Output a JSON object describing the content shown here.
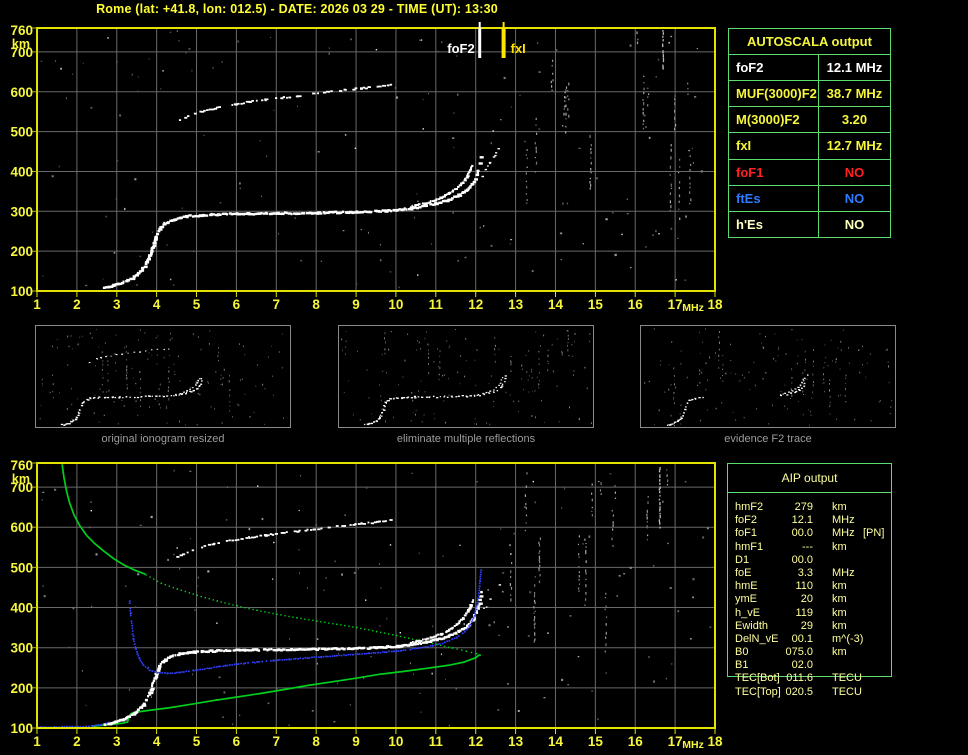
{
  "title": "Rome (lat: +41.8, lon: 012.5) - DATE: 2026 03 29 - TIME (UT): 13:30",
  "colors": {
    "background": "#000000",
    "axis_yellow": "#f6f63c",
    "plot_border": "#e3e300",
    "grid": "#696969",
    "table_border": "#5adc6e",
    "echo_white": "#ffffff",
    "profile_green": "#00cf1d",
    "restored_blue": "#2e3eff",
    "caption_gray": "#9c9c9c",
    "aip_text": "#ffff9c"
  },
  "axes": {
    "x_ticks": [
      "1",
      "2",
      "3",
      "4",
      "5",
      "6",
      "7",
      "8",
      "9",
      "10",
      "11",
      "12",
      "13",
      "14",
      "15",
      "16",
      "17",
      "18"
    ],
    "x_unit": "MHz",
    "y_ticks": [
      "760",
      "700",
      "600",
      "500",
      "400",
      "300",
      "200",
      "100"
    ],
    "y_unit": "km",
    "x_range": [
      1,
      18
    ],
    "y_range": [
      100,
      760
    ]
  },
  "markers": {
    "fof2": {
      "label": "foF2",
      "freq_mhz": 12.1,
      "color": "#ffffff"
    },
    "fxi": {
      "label": "fxI",
      "freq_mhz": 12.7,
      "color": "#ffe400"
    }
  },
  "autoscala": {
    "header": "AUTOSCALA output",
    "rows": [
      {
        "label": "foF2",
        "value": "12.1 MHz",
        "color": "#ffffff"
      },
      {
        "label": "MUF(3000)F2",
        "value": "38.7 MHz",
        "color": "#f6f63c"
      },
      {
        "label": "M(3000)F2",
        "value": "3.20",
        "color": "#f6f63c"
      },
      {
        "label": "fxI",
        "value": "12.7 MHz",
        "color": "#f6f63c"
      },
      {
        "label": "foF1",
        "value": "NO",
        "color": "#ff2222"
      },
      {
        "label": "ftEs",
        "value": "NO",
        "color": "#2e7bff"
      },
      {
        "label": "h'Es",
        "value": "NO",
        "color": "#ffffc0"
      }
    ]
  },
  "aip": {
    "header": "AIP output",
    "rows": [
      {
        "label": "hmF2",
        "value": "279",
        "unit": "km",
        "note": ""
      },
      {
        "label": "foF2",
        "value": "12.1",
        "unit": "MHz",
        "note": ""
      },
      {
        "label": "foF1",
        "value": "00.0",
        "unit": "MHz",
        "note": "[PN]"
      },
      {
        "label": "hmF1",
        "value": "---",
        "unit": "km",
        "note": ""
      },
      {
        "label": "D1",
        "value": "00.0",
        "unit": "",
        "note": ""
      },
      {
        "label": "foE",
        "value": "3.3",
        "unit": "MHz",
        "note": ""
      },
      {
        "label": "hmE",
        "value": "110",
        "unit": "km",
        "note": ""
      },
      {
        "label": "ymE",
        "value": "20",
        "unit": "km",
        "note": ""
      },
      {
        "label": "h_vE",
        "value": "119",
        "unit": "km",
        "note": ""
      },
      {
        "label": "Ewidth",
        "value": "29",
        "unit": "km",
        "note": ""
      },
      {
        "label": "DelN_vE",
        "value": "00.1",
        "unit": "m^(-3)",
        "note": ""
      },
      {
        "label": "B0",
        "value": "075.0",
        "unit": "km",
        "note": ""
      },
      {
        "label": "B1",
        "value": "02.0",
        "unit": "",
        "note": ""
      },
      {
        "label": "TEC[Bot]",
        "value": "011.6",
        "unit": "TECU",
        "note": ""
      },
      {
        "label": "TEC[Top]",
        "value": "020.5",
        "unit": "TECU",
        "note": ""
      }
    ]
  },
  "panels": [
    {
      "caption": "original ionogram resized",
      "traces": [
        "main",
        "branch2",
        "hop2"
      ]
    },
    {
      "caption": "eliminate multiple reflections",
      "traces": [
        "main",
        "branch2"
      ]
    },
    {
      "caption": "evidence F2 trace",
      "traces": [
        "frag1",
        "frag2",
        "frag2b"
      ]
    }
  ],
  "chart_data": {
    "type": "scatter",
    "xlabel": "MHz",
    "ylabel": "km",
    "xlim": [
      1,
      18
    ],
    "ylim": [
      100,
      760
    ],
    "plots": [
      {
        "name": "scaled-ionogram",
        "traces": [
          "main",
          "branch2",
          "hop2",
          "xmode"
        ],
        "markers": [
          "foF2 12.1 MHz",
          "fxI 12.7 MHz"
        ]
      },
      {
        "name": "ionogram-with-profile",
        "traces": [
          "green_top_solid",
          "green_top_dot",
          "green_bottom",
          "blue_E",
          "main",
          "branch2",
          "hop2",
          "xmode",
          "blue_F"
        ]
      }
    ],
    "traces": {
      "main": {
        "style": "blocks",
        "color": "#ffffff",
        "points": [
          [
            2.65,
            110
          ],
          [
            2.8,
            114
          ],
          [
            2.95,
            118
          ],
          [
            3.1,
            124
          ],
          [
            3.25,
            130
          ],
          [
            3.4,
            138
          ],
          [
            3.52,
            148
          ],
          [
            3.63,
            160
          ],
          [
            3.72,
            174
          ],
          [
            3.8,
            192
          ],
          [
            3.87,
            212
          ],
          [
            3.95,
            236
          ],
          [
            4.05,
            258
          ],
          [
            4.18,
            272
          ],
          [
            4.35,
            281
          ],
          [
            4.55,
            287
          ],
          [
            4.8,
            291
          ],
          [
            5.1,
            293
          ],
          [
            5.5,
            295
          ],
          [
            6.0,
            297
          ],
          [
            6.5,
            297
          ],
          [
            7.0,
            298
          ],
          [
            7.5,
            298
          ],
          [
            8.0,
            299
          ],
          [
            8.5,
            300
          ],
          [
            9.0,
            301
          ],
          [
            9.5,
            303
          ],
          [
            10.0,
            306
          ],
          [
            10.35,
            310
          ],
          [
            10.7,
            316
          ],
          [
            11.0,
            323
          ],
          [
            11.3,
            332
          ],
          [
            11.55,
            343
          ],
          [
            11.75,
            356
          ],
          [
            11.88,
            370
          ],
          [
            11.97,
            386
          ],
          [
            12.03,
            404
          ],
          [
            12.07,
            422
          ],
          [
            12.1,
            442
          ]
        ]
      },
      "branch2": {
        "style": "blocks2",
        "color": "#ffffff",
        "points": [
          [
            10.35,
            314
          ],
          [
            10.6,
            320
          ],
          [
            10.85,
            327
          ],
          [
            11.1,
            336
          ],
          [
            11.3,
            347
          ],
          [
            11.5,
            360
          ],
          [
            11.65,
            375
          ],
          [
            11.77,
            392
          ],
          [
            11.85,
            408
          ],
          [
            11.9,
            422
          ]
        ]
      },
      "hop2": {
        "style": "dotblocks",
        "color": "#ffffff",
        "points": [
          [
            4.5,
            528
          ],
          [
            4.75,
            540
          ],
          [
            5.0,
            550
          ],
          [
            5.3,
            558
          ],
          [
            5.6,
            565
          ],
          [
            5.95,
            571
          ],
          [
            6.3,
            577
          ],
          [
            6.7,
            582
          ],
          [
            7.1,
            587
          ],
          [
            7.5,
            592
          ],
          [
            7.9,
            597
          ],
          [
            8.3,
            602
          ],
          [
            8.7,
            607
          ],
          [
            9.1,
            611
          ],
          [
            9.5,
            615
          ],
          [
            9.85,
            619
          ]
        ]
      },
      "xmode": {
        "style": "sparse",
        "color": "#ffffff",
        "points": [
          [
            12.15,
            390
          ],
          [
            12.25,
            405
          ],
          [
            12.35,
            422
          ],
          [
            12.45,
            440
          ],
          [
            12.55,
            458
          ]
        ]
      },
      "blue_E": {
        "style": "dots",
        "color": "#2e3eff",
        "points": [
          [
            1.0,
            104
          ],
          [
            1.2,
            104
          ],
          [
            1.4,
            104
          ],
          [
            1.6,
            105
          ],
          [
            1.8,
            105
          ],
          [
            2.0,
            105
          ],
          [
            2.2,
            106
          ],
          [
            2.35,
            107
          ],
          [
            2.5,
            109
          ],
          [
            2.65,
            112
          ],
          [
            2.78,
            116
          ]
        ]
      },
      "blue_F": {
        "style": "dots",
        "color": "#2e3eff",
        "points": [
          [
            3.3,
            418
          ],
          [
            3.33,
            388
          ],
          [
            3.36,
            356
          ],
          [
            3.4,
            324
          ],
          [
            3.46,
            298
          ],
          [
            3.54,
            276
          ],
          [
            3.65,
            258
          ],
          [
            3.8,
            246
          ],
          [
            4.0,
            240
          ],
          [
            4.25,
            238
          ],
          [
            4.55,
            240
          ],
          [
            4.9,
            245
          ],
          [
            5.3,
            251
          ],
          [
            5.7,
            257
          ],
          [
            6.1,
            262
          ],
          [
            6.5,
            266
          ],
          [
            6.9,
            270
          ],
          [
            7.3,
            273
          ],
          [
            7.7,
            276
          ],
          [
            8.1,
            279
          ],
          [
            8.5,
            282
          ],
          [
            8.9,
            285
          ],
          [
            9.3,
            288
          ],
          [
            9.7,
            291
          ],
          [
            10.1,
            295
          ],
          [
            10.5,
            300
          ],
          [
            10.9,
            307
          ],
          [
            11.2,
            315
          ],
          [
            11.5,
            327
          ],
          [
            11.7,
            342
          ],
          [
            11.85,
            360
          ],
          [
            11.95,
            382
          ],
          [
            12.02,
            408
          ],
          [
            12.06,
            438
          ],
          [
            12.09,
            468
          ],
          [
            12.11,
            495
          ]
        ]
      },
      "green_top_solid": {
        "style": "line",
        "color": "#00cf1d",
        "points": [
          [
            1.63,
            757
          ],
          [
            1.68,
            722
          ],
          [
            1.74,
            690
          ],
          [
            1.82,
            660
          ],
          [
            1.93,
            630
          ],
          [
            2.07,
            604
          ],
          [
            2.24,
            580
          ],
          [
            2.44,
            560
          ],
          [
            2.67,
            541
          ],
          [
            2.92,
            522
          ],
          [
            3.18,
            506
          ],
          [
            3.45,
            493
          ],
          [
            3.72,
            483
          ]
        ]
      },
      "green_top_dot": {
        "style": "dotline",
        "color": "#00cf1d",
        "points": [
          [
            3.72,
            483
          ],
          [
            4.1,
            462
          ],
          [
            4.5,
            448
          ],
          [
            5.0,
            432
          ],
          [
            5.5,
            418
          ],
          [
            6.0,
            406
          ],
          [
            6.5,
            395
          ],
          [
            7.0,
            385
          ],
          [
            7.5,
            376
          ],
          [
            8.0,
            368
          ],
          [
            8.5,
            360
          ],
          [
            9.0,
            352
          ],
          [
            9.5,
            342
          ],
          [
            10.0,
            332
          ],
          [
            10.5,
            321
          ],
          [
            11.0,
            310
          ],
          [
            11.4,
            301
          ],
          [
            11.75,
            293
          ],
          [
            12.0,
            287
          ],
          [
            12.1,
            283
          ]
        ]
      },
      "green_bottom": {
        "style": "line",
        "color": "#00cf1d",
        "points": [
          [
            12.1,
            283
          ],
          [
            12.0,
            275
          ],
          [
            11.7,
            264
          ],
          [
            11.3,
            256
          ],
          [
            10.8,
            249
          ],
          [
            10.2,
            241
          ],
          [
            9.6,
            234
          ],
          [
            9.0,
            224
          ],
          [
            8.4,
            215
          ],
          [
            7.8,
            206
          ],
          [
            7.2,
            196
          ],
          [
            6.6,
            186
          ],
          [
            6.0,
            177
          ],
          [
            5.4,
            168
          ],
          [
            4.8,
            158
          ],
          [
            4.3,
            150
          ],
          [
            3.9,
            145
          ],
          [
            3.6,
            141
          ],
          [
            3.4,
            138
          ],
          [
            3.33,
            133
          ],
          [
            3.3,
            124
          ],
          [
            3.27,
            115
          ],
          [
            3.15,
            112
          ],
          [
            2.95,
            110
          ],
          [
            2.75,
            108
          ],
          [
            2.55,
            106
          ],
          [
            2.38,
            104
          ]
        ]
      },
      "frag1": {
        "ref": "main",
        "frange": [
          2.6,
          5.4
        ]
      },
      "frag2": {
        "ref": "main",
        "frange": [
          10.15,
          12.12
        ]
      },
      "frag2b": {
        "ref": "branch2",
        "frange": [
          10.3,
          11.92
        ]
      }
    }
  }
}
